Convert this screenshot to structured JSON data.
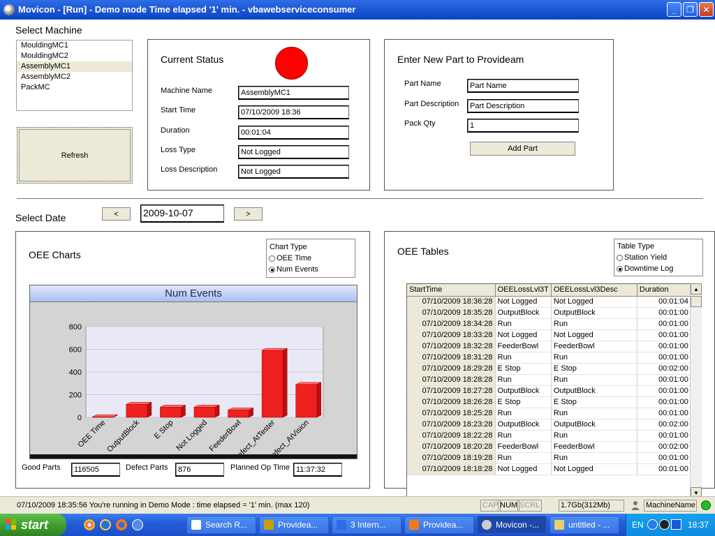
{
  "window": {
    "title": "Movicon - [Run] - Demo mode Time elapsed '1' min. - vbawebserviceconsumer",
    "minimize": "_",
    "restore": "❐",
    "close": "✕"
  },
  "machine_select": {
    "label": "Select Machine",
    "items": [
      "MouldingMC1",
      "MouldingMC2",
      "AssemblyMC1",
      "AssemblyMC2",
      "PackMC"
    ],
    "selected": "AssemblyMC1",
    "refresh_label": "Refresh"
  },
  "current_status": {
    "title": "Current Status",
    "indicator_color": "#ff0000",
    "fields": [
      {
        "label": "Machine Name",
        "value": "AssemblyMC1"
      },
      {
        "label": "Start Time",
        "value": "07/10/2009 18:36"
      },
      {
        "label": "Duration",
        "value": "00:01:04"
      },
      {
        "label": "Loss Type",
        "value": "Not Logged"
      },
      {
        "label": "Loss Description",
        "value": "Not Logged"
      }
    ]
  },
  "new_part": {
    "title": "Enter New Part to Provideam",
    "fields": [
      {
        "label": "Part Name",
        "value": "Part Name"
      },
      {
        "label": "Part Description",
        "value": "Part Description"
      },
      {
        "label": "Pack Qty",
        "value": "1"
      }
    ],
    "add_label": "Add Part"
  },
  "date_select": {
    "label": "Select Date",
    "prev": "<",
    "next": ">",
    "value": "2009-10-07"
  },
  "oee_charts": {
    "title": "OEE Charts",
    "chart_type_label": "Chart Type",
    "options": [
      "OEE Time",
      "Num Events"
    ],
    "selected": "Num Events",
    "good_parts_label": "Good Parts",
    "good_parts": "116505",
    "defect_parts_label": "Defect Parts",
    "defect_parts": "876",
    "planned_label": "Planned Op Time",
    "planned": "11:37:32"
  },
  "chart_data": {
    "type": "bar",
    "title": "Num Events",
    "categories": [
      "OEE Time",
      "OutputBlock",
      "E Stop",
      "Not Logged",
      "FeederBowl",
      "Defect_AtTester",
      "Defect_AtVision"
    ],
    "values": [
      5,
      115,
      90,
      90,
      65,
      590,
      290
    ],
    "ylim": [
      0,
      800
    ],
    "yticks": [
      0,
      200,
      400,
      600,
      800
    ],
    "bar_color": "#ee2020",
    "grid": true
  },
  "oee_tables": {
    "title": "OEE Tables",
    "table_type_label": "Table Type",
    "options": [
      "Station Yield",
      "Downtime Log"
    ],
    "selected": "Downtime Log",
    "columns": [
      "StartTime",
      "OEELossLvl3T",
      "OEELossLvl3Desc",
      "Duration"
    ],
    "rows": [
      [
        "07/10/2009 18:36:28",
        "Not Logged",
        "Not Logged",
        "00:01:04"
      ],
      [
        "07/10/2009 18:35:28",
        "OutputBlock",
        "OutputBlock",
        "00:01:00"
      ],
      [
        "07/10/2009 18:34:28",
        "Run",
        "Run",
        "00:01:00"
      ],
      [
        "07/10/2009 18:33:28",
        "Not Logged",
        "Not Logged",
        "00:01:00"
      ],
      [
        "07/10/2009 18:32:28",
        "FeederBowl",
        "FeederBowl",
        "00:01:00"
      ],
      [
        "07/10/2009 18:31:28",
        "Run",
        "Run",
        "00:01:00"
      ],
      [
        "07/10/2009 18:29:28",
        "E Stop",
        "E Stop",
        "00:02:00"
      ],
      [
        "07/10/2009 18:28:28",
        "Run",
        "Run",
        "00:01:00"
      ],
      [
        "07/10/2009 18:27:28",
        "OutputBlock",
        "OutputBlock",
        "00:01:00"
      ],
      [
        "07/10/2009 18:26:28",
        "E Stop",
        "E Stop",
        "00:01:00"
      ],
      [
        "07/10/2009 18:25:28",
        "Run",
        "Run",
        "00:01:00"
      ],
      [
        "07/10/2009 18:23:28",
        "OutputBlock",
        "OutputBlock",
        "00:02:00"
      ],
      [
        "07/10/2009 18:22:28",
        "Run",
        "Run",
        "00:01:00"
      ],
      [
        "07/10/2009 18:20:28",
        "FeederBowl",
        "FeederBowl",
        "00:02:00"
      ],
      [
        "07/10/2009 18:19:28",
        "Run",
        "Run",
        "00:01:00"
      ],
      [
        "07/10/2009 18:18:28",
        "Not Logged",
        "Not Logged",
        "00:01:00"
      ]
    ]
  },
  "statusbar": {
    "message": "07/10/2009 18:35:56 You're running in Demo Mode : time elapsed = '1' min. (max 120)",
    "cap": "CAP",
    "num": "NUM",
    "scrl": "SCRL",
    "memory": "1.7Gb(312Mb)",
    "user": "MachineName",
    "status_color": "#22bb22"
  },
  "taskbar": {
    "start": "start",
    "tasks": [
      "Search R...",
      "Providea...",
      "3 Intern...",
      "Providea...",
      "Movicon -...",
      "untitled - ..."
    ],
    "language": "EN",
    "clock": "18:37"
  }
}
